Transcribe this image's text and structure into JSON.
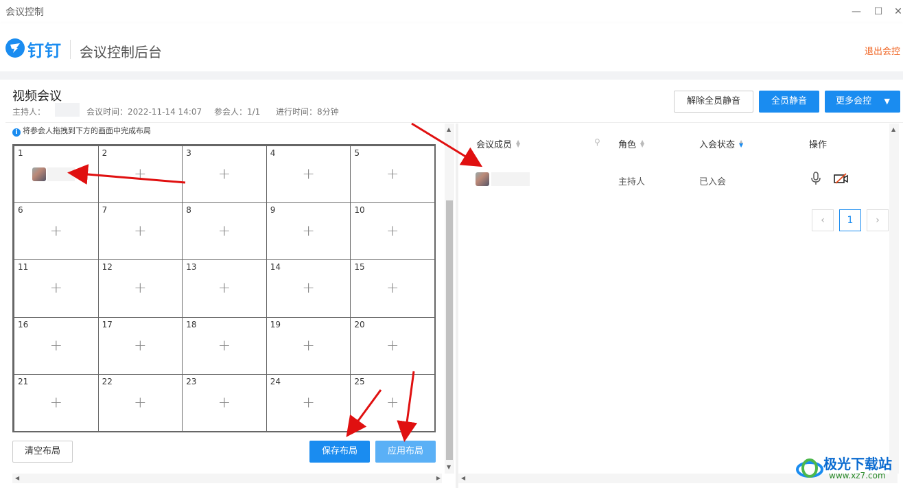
{
  "window": {
    "title": "会议控制",
    "minimize": "—",
    "maximize": "☐",
    "close": "✕"
  },
  "header": {
    "brand": "钉钉",
    "title": "会议控制后台",
    "logout": "退出会控"
  },
  "meeting": {
    "title": "视频会议",
    "host_label": "主持人：",
    "time": "会议时间：2022-11-14 14:07",
    "participants": "参会人：1/1",
    "elapsed": "进行时间：8分钟"
  },
  "actions": {
    "unmute_all": "解除全员静音",
    "mute_all": "全员静音",
    "more": "更多会控"
  },
  "layout": {
    "tip": "将参会人拖拽到下方的画面中完成布局",
    "cells": [
      "1",
      "2",
      "3",
      "4",
      "5",
      "6",
      "7",
      "8",
      "9",
      "10",
      "11",
      "12",
      "13",
      "14",
      "15",
      "16",
      "17",
      "18",
      "19",
      "20",
      "21",
      "22",
      "23",
      "24",
      "25"
    ],
    "plus": "+",
    "clear": "清空布局",
    "save": "保存布局",
    "apply": "应用布局"
  },
  "members": {
    "headers": {
      "member": "会议成员",
      "role": "角色",
      "status": "入会状态",
      "ops": "操作"
    },
    "rows": [
      {
        "role": "主持人",
        "status": "已入会"
      }
    ],
    "page": "1",
    "prev": "‹",
    "next": "›"
  },
  "watermark": {
    "text": "极光下载站",
    "url": "www.xz7.com"
  },
  "colors": {
    "accent": "#1a8cf0",
    "logout": "#f06422",
    "arrow": "#e01010"
  }
}
